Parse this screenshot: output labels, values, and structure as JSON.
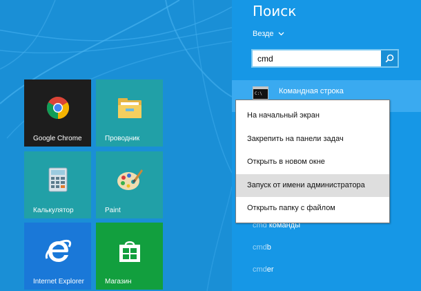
{
  "tiles": [
    {
      "label": "Google Chrome",
      "icon": "chrome-icon",
      "color": "#1d1d1d"
    },
    {
      "label": "Проводник",
      "icon": "folder-icon",
      "color": "#21a0a7"
    },
    {
      "label": "Калькулятор",
      "icon": "calculator-icon",
      "color": "#21a0a7"
    },
    {
      "label": "Paint",
      "icon": "paint-palette-icon",
      "color": "#21a0a7"
    },
    {
      "label": "Internet Explorer",
      "icon": "internet-explorer-icon",
      "color": "#1a78d8"
    },
    {
      "label": "Магазин",
      "icon": "store-icon",
      "color": "#129f3e"
    }
  ],
  "search": {
    "title": "Поиск",
    "scope": "Везде",
    "query": "cmd"
  },
  "results": {
    "top": "Командная строка",
    "items": [
      {
        "prefix": "cmd",
        "rest": " команды"
      },
      {
        "prefix": "cmd",
        "rest": "b"
      },
      {
        "prefix": "cmd",
        "rest": "er"
      }
    ]
  },
  "context_menu": {
    "items": [
      "На начальный экран",
      "Закрепить на панели задач",
      "Открыть в новом окне",
      "Запуск от имени администратора",
      "Открыть папку с файлом"
    ],
    "highlighted_index": 3
  },
  "colors": {
    "background": "#1a8fd6",
    "search_pane": "#1697e6",
    "selected_result": "#3aaaf0",
    "menu_highlight": "#dedede"
  }
}
